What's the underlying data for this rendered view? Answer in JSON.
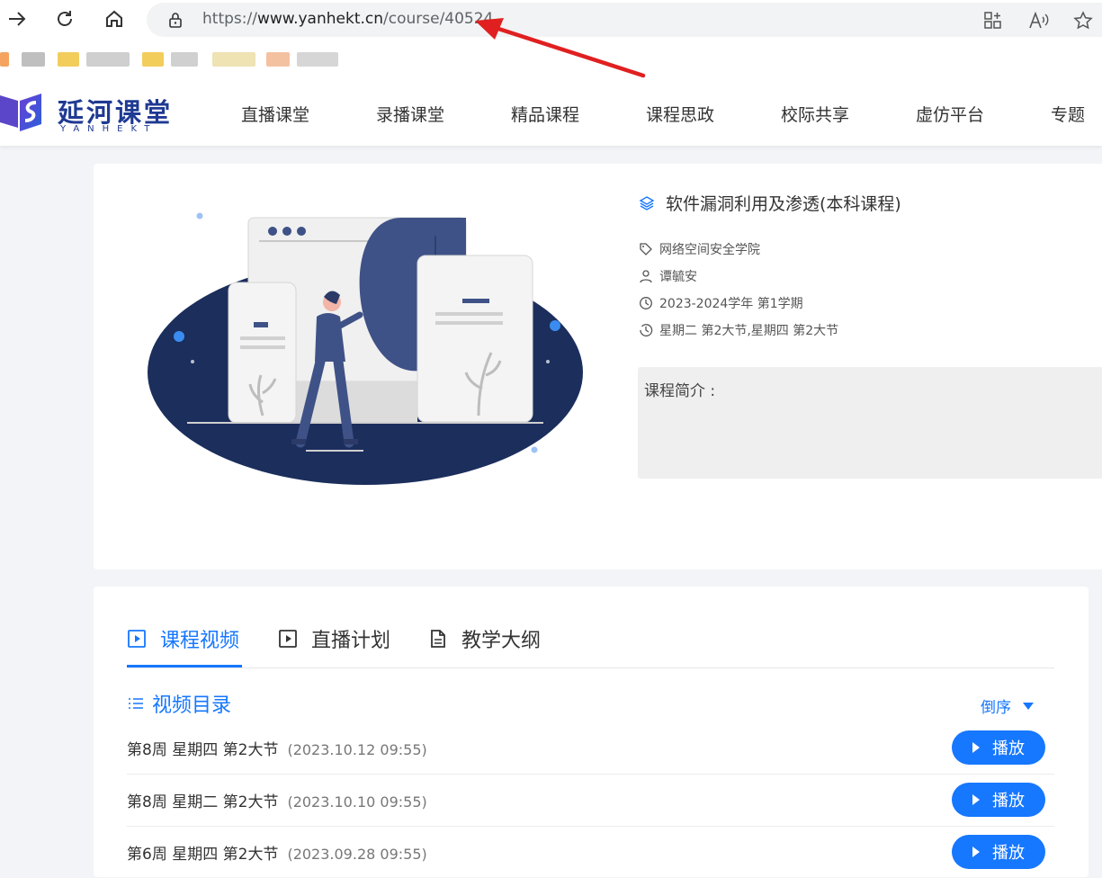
{
  "browser": {
    "url_scheme": "https://",
    "url_host": "www.yanhekt.cn",
    "url_path": "/course/40524",
    "icons": [
      "forward-icon",
      "reload-icon",
      "home-icon",
      "lock-icon",
      "split-screen-icon",
      "read-aloud-icon",
      "favorite-star-icon"
    ]
  },
  "header": {
    "logo_text": "延河课堂",
    "logo_sub": "YANHEKT",
    "nav": [
      "直播课堂",
      "录播课堂",
      "精品课程",
      "课程思政",
      "校际共享",
      "虚仿平台",
      "专题"
    ]
  },
  "course": {
    "title": "软件漏洞利用及渗透(本科课程)",
    "college": "网络空间安全学院",
    "teacher": "谭毓安",
    "term": "2023-2024学年 第1学期",
    "schedule": "星期二 第2大节,星期四 第2大节",
    "intro_label": "课程简介 :"
  },
  "tabs": [
    {
      "label": "课程视频",
      "active": true
    },
    {
      "label": "直播计划",
      "active": false
    },
    {
      "label": "教学大纲",
      "active": false
    }
  ],
  "videos": {
    "section_title": "视频目录",
    "sort_label": "倒序",
    "play_label": "播放",
    "rows": [
      {
        "label": "第8周 星期四 第2大节",
        "time": "(2023.10.12 09:55)"
      },
      {
        "label": "第8周 星期二 第2大节",
        "time": "(2023.10.10 09:55)"
      },
      {
        "label": "第6周 星期四 第2大节",
        "time": "(2023.09.28 09:55)"
      }
    ]
  },
  "colors": {
    "accent": "#1677ff",
    "brand": "#1f3a93",
    "annotation": "#e02020"
  }
}
